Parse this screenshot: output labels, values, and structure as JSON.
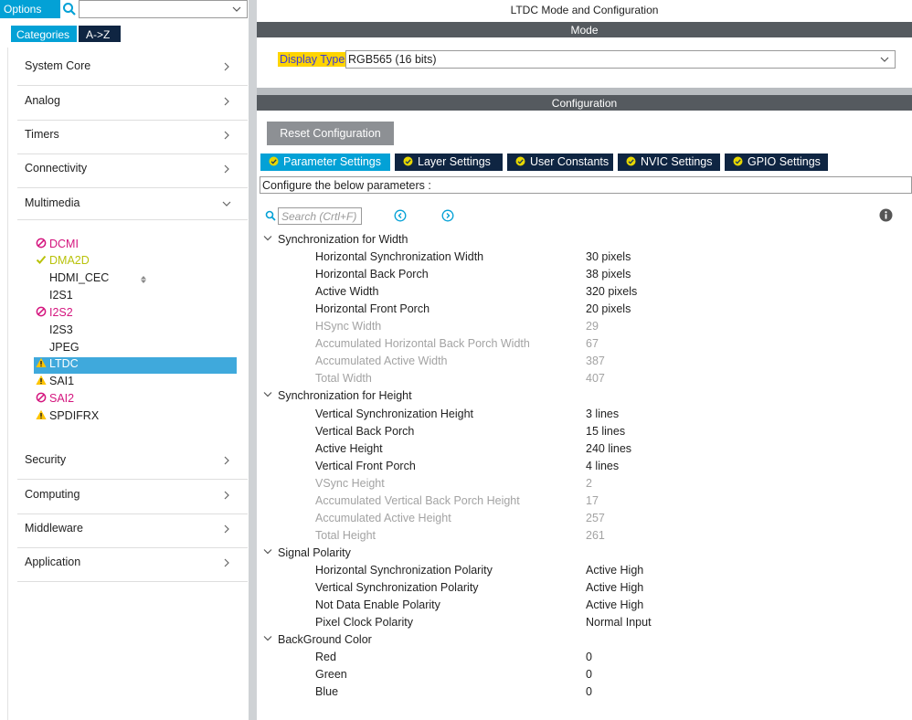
{
  "left": {
    "options_label": "Options",
    "tab_categories": "Categories",
    "tab_az": "A->Z",
    "categories": [
      {
        "label": "System Core"
      },
      {
        "label": "Analog"
      },
      {
        "label": "Timers"
      },
      {
        "label": "Connectivity"
      },
      {
        "label": "Multimedia"
      },
      {
        "label": "Security"
      },
      {
        "label": "Computing"
      },
      {
        "label": "Middleware"
      },
      {
        "label": "Application"
      }
    ],
    "multimedia_items": [
      {
        "label": "DCMI",
        "state": "disabled"
      },
      {
        "label": "DMA2D",
        "state": "enabled"
      },
      {
        "label": "HDMI_CEC",
        "state": "none"
      },
      {
        "label": "I2S1",
        "state": "none"
      },
      {
        "label": "I2S2",
        "state": "disabled"
      },
      {
        "label": "I2S3",
        "state": "none"
      },
      {
        "label": "JPEG",
        "state": "none"
      },
      {
        "label": "LTDC",
        "state": "warning",
        "selected": true
      },
      {
        "label": "SAI1",
        "state": "warning"
      },
      {
        "label": "SAI2",
        "state": "disabled"
      },
      {
        "label": "SPDIFRX",
        "state": "warning"
      }
    ]
  },
  "main": {
    "title": "LTDC Mode and Configuration",
    "mode_band": "Mode",
    "display_type_label": "Display Type",
    "display_type_value": "RGB565 (16 bits)",
    "config_band": "Configuration",
    "reset_button": "Reset Configuration",
    "tabs": [
      {
        "label": "Parameter Settings"
      },
      {
        "label": "Layer Settings"
      },
      {
        "label": "User Constants"
      },
      {
        "label": "NVIC Settings"
      },
      {
        "label": "GPIO Settings"
      }
    ],
    "configure_text": "Configure the below parameters :",
    "search_placeholder": "Search (Crtl+F)",
    "groups": [
      {
        "title": "Synchronization for Width",
        "params": [
          {
            "name": "Horizontal Synchronization Width",
            "value": "30 pixels",
            "dim": false
          },
          {
            "name": "Horizontal Back Porch",
            "value": "38 pixels",
            "dim": false
          },
          {
            "name": "Active Width",
            "value": "320 pixels",
            "dim": false
          },
          {
            "name": "Horizontal Front Porch",
            "value": "20 pixels",
            "dim": false
          },
          {
            "name": "HSync Width",
            "value": "29",
            "dim": true
          },
          {
            "name": "Accumulated Horizontal Back Porch Width",
            "value": "67",
            "dim": true
          },
          {
            "name": "Accumulated Active Width",
            "value": "387",
            "dim": true
          },
          {
            "name": "Total Width",
            "value": "407",
            "dim": true
          }
        ]
      },
      {
        "title": "Synchronization for Height",
        "params": [
          {
            "name": "Vertical Synchronization Height",
            "value": "3 lines",
            "dim": false
          },
          {
            "name": "Vertical Back Porch",
            "value": "15 lines",
            "dim": false
          },
          {
            "name": "Active Height",
            "value": "240 lines",
            "dim": false
          },
          {
            "name": "Vertical Front Porch",
            "value": "4 lines",
            "dim": false
          },
          {
            "name": "VSync Height",
            "value": "2",
            "dim": true
          },
          {
            "name": "Accumulated Vertical Back Porch Height",
            "value": "17",
            "dim": true
          },
          {
            "name": "Accumulated Active Height",
            "value": "257",
            "dim": true
          },
          {
            "name": "Total Height",
            "value": "261",
            "dim": true
          }
        ]
      },
      {
        "title": "Signal Polarity",
        "params": [
          {
            "name": "Horizontal Synchronization Polarity",
            "value": "Active High",
            "dim": false
          },
          {
            "name": "Vertical Synchronization Polarity",
            "value": "Active High",
            "dim": false
          },
          {
            "name": "Not Data Enable Polarity",
            "value": "Active High",
            "dim": false
          },
          {
            "name": "Pixel Clock Polarity",
            "value": "Normal Input",
            "dim": false
          }
        ]
      },
      {
        "title": "BackGround Color",
        "params": [
          {
            "name": "Red",
            "value": "0",
            "dim": false
          },
          {
            "name": "Green",
            "value": "0",
            "dim": false
          },
          {
            "name": "Blue",
            "value": "0",
            "dim": false
          }
        ]
      }
    ]
  },
  "colors": {
    "accent": "#03a1d6",
    "tab_dark": "#0f2542",
    "band": "#555a5f",
    "selected_row": "#3fa9dc",
    "disabled_pink": "#d4157e",
    "enabled_lime": "#b9c20a",
    "warning_yellow": "#ffd400"
  }
}
